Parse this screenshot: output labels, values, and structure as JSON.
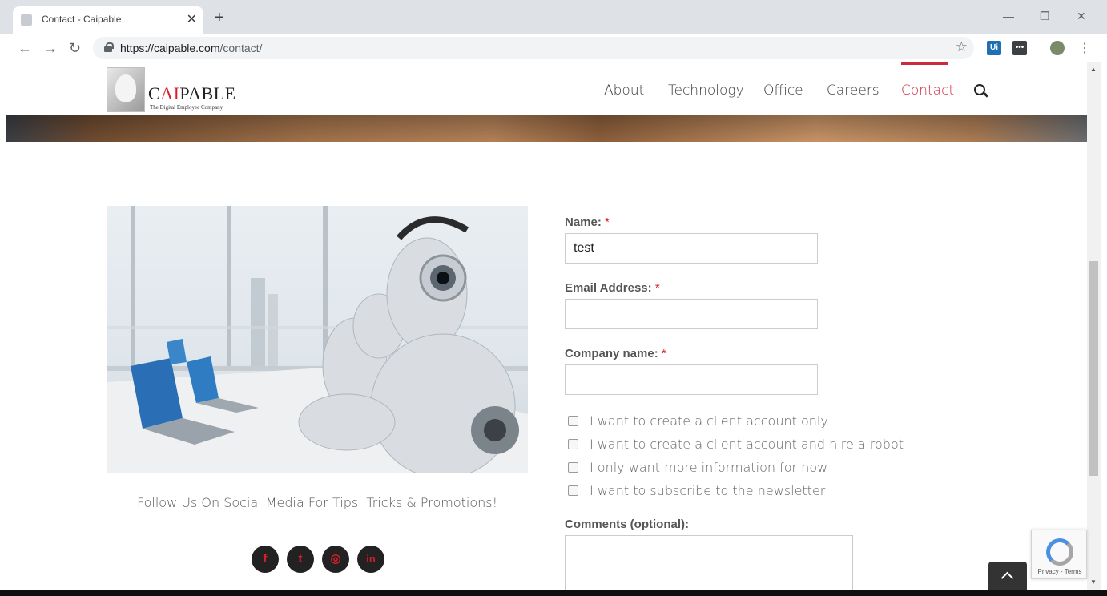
{
  "browser": {
    "tab_title": "Contact - Caipable",
    "new_tab": "+",
    "close_tab": "✕",
    "url_host": "https://caipable.com",
    "url_path": "/contact/",
    "extensions": [
      "Ui",
      "•••"
    ]
  },
  "site": {
    "logo": {
      "pre": "C",
      "mid": "AI",
      "post": "PABLE",
      "tagline": "The Digital Employee Company"
    },
    "nav": [
      "About",
      "Technology",
      "Office",
      "Careers",
      "Contact"
    ],
    "active_nav": "Contact"
  },
  "social": {
    "text": "Follow Us On Social Media For Tips, Tricks & Promotions!",
    "icons": [
      "f",
      "t",
      "◎",
      "in"
    ]
  },
  "form": {
    "name_label": "Name:",
    "name_value": "test",
    "email_label": "Email Address:",
    "email_value": "",
    "company_label": "Company name:",
    "company_value": "",
    "required_mark": "*",
    "checkboxes": [
      "I want to create a client account only",
      "I want to create a client account and hire a robot",
      "I only want more information for now",
      "I want to subscribe to the newsletter"
    ],
    "comments_label": "Comments (optional):"
  },
  "recaptcha": {
    "text": "Privacy - Terms"
  },
  "colors": {
    "accent": "#cc2a3e",
    "social_bg": "#222222"
  }
}
